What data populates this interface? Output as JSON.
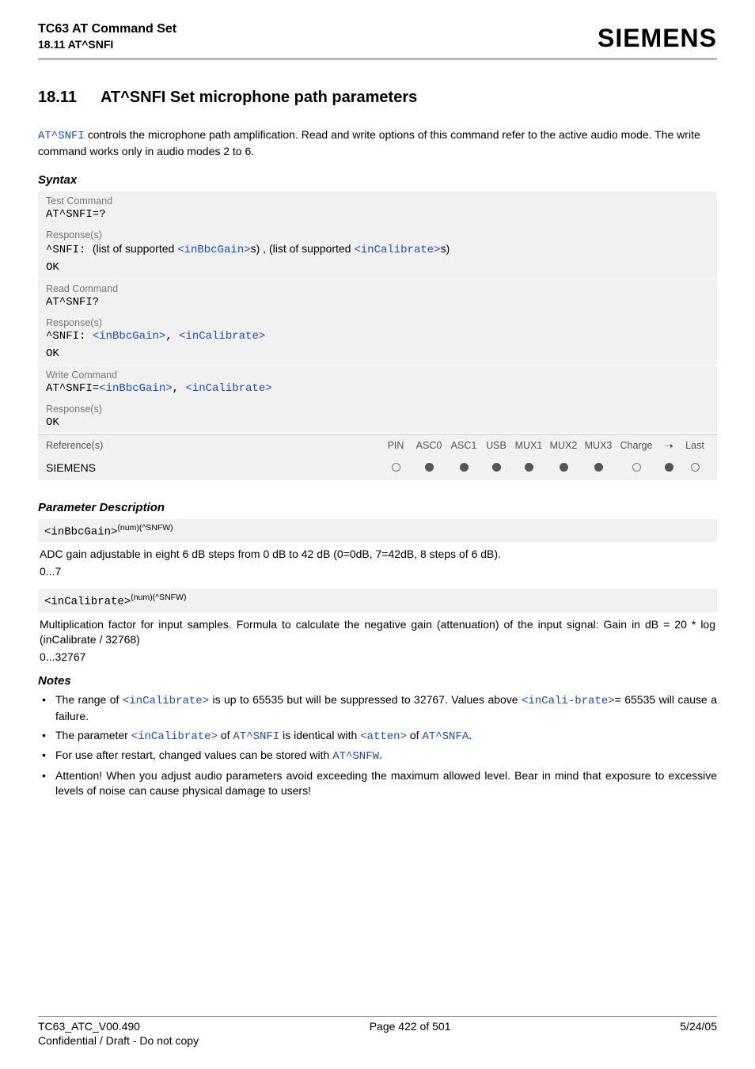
{
  "header": {
    "doc_title": "TC63 AT Command Set",
    "doc_subtitle": "18.11 AT^SNFI",
    "brand": "SIEMENS"
  },
  "section": {
    "number": "18.11",
    "title": "AT^SNFI   Set microphone path parameters"
  },
  "intro": {
    "cmd": "AT^SNFI",
    "rest": " controls the microphone path amplification. Read and write options of this command refer to the active audio mode. The write command works only in audio modes 2 to 6."
  },
  "syntax_heading": "Syntax",
  "syntax": {
    "test": {
      "label": "Test Command",
      "cmd": "AT^SNFI=?",
      "resp_label": "Response(s)",
      "resp_prefix": "^SNFI: ",
      "resp_text1": "(list of supported ",
      "param1": "<inBbcGain>",
      "resp_text2": "s) , (list of supported ",
      "param2": "<inCalibrate>",
      "resp_text3": "s)",
      "ok": "OK"
    },
    "read": {
      "label": "Read Command",
      "cmd": "AT^SNFI?",
      "resp_label": "Response(s)",
      "resp_prefix": "^SNFI: ",
      "param1": "<inBbcGain>",
      "sep": ", ",
      "param2": "<inCalibrate>",
      "ok": "OK"
    },
    "write": {
      "label": "Write Command",
      "cmd_prefix": "AT^SNFI=",
      "param1": "<inBbcGain>",
      "sep": ", ",
      "param2": "<inCalibrate>",
      "resp_label": "Response(s)",
      "ok": "OK"
    },
    "ref": {
      "refs_label": "Reference(s)",
      "cols": [
        "PIN",
        "ASC0",
        "ASC1",
        "USB",
        "MUX1",
        "MUX2",
        "MUX3",
        "Charge",
        "➝",
        "Last"
      ],
      "vendor": "SIEMENS",
      "dots": [
        "open",
        "filled",
        "filled",
        "filled",
        "filled",
        "filled",
        "filled",
        "open",
        "filled",
        "open"
      ]
    }
  },
  "param_desc_heading": "Parameter Description",
  "params": {
    "inBbcGain": {
      "name": "<inBbcGain>",
      "sup": "(num)(^SNFW)",
      "desc": "ADC gain adjustable in eight 6 dB steps from 0 dB to 42 dB (0=0dB, 7=42dB, 8 steps of 6 dB).",
      "range": "0...7"
    },
    "inCalibrate": {
      "name": "<inCalibrate>",
      "sup": "(num)(^SNFW)",
      "desc": "Multiplication factor for input samples. Formula to calculate the negative gain (attenuation) of the input signal: Gain in dB = 20 * log (inCalibrate / 32768)",
      "range": "0...32767"
    }
  },
  "notes_heading": "Notes",
  "notes": {
    "n1a": "The range of ",
    "n1b": "<inCalibrate>",
    "n1c": " is up to 65535 but will be suppressed to 32767. Values above ",
    "n1d": "<inCali-brate>",
    "n1e": "= 65535 will cause a failure.",
    "n2a": "The parameter ",
    "n2b": "<inCalibrate>",
    "n2c": " of ",
    "n2d": "AT^SNFI",
    "n2e": " is identical with ",
    "n2f": "<atten>",
    "n2g": " of ",
    "n2h": "AT^SNFA",
    "n2i": ".",
    "n3a": "For use after restart, changed values can be stored with ",
    "n3b": "AT^SNFW",
    "n3c": ".",
    "n4": "Attention! When you adjust audio parameters avoid exceeding the maximum allowed level. Bear in mind that exposure to excessive levels of noise can cause physical damage to users!"
  },
  "footer": {
    "left": "TC63_ATC_V00.490",
    "center": "Page 422 of 501",
    "right": "5/24/05",
    "sub": "Confidential / Draft - Do not copy"
  }
}
